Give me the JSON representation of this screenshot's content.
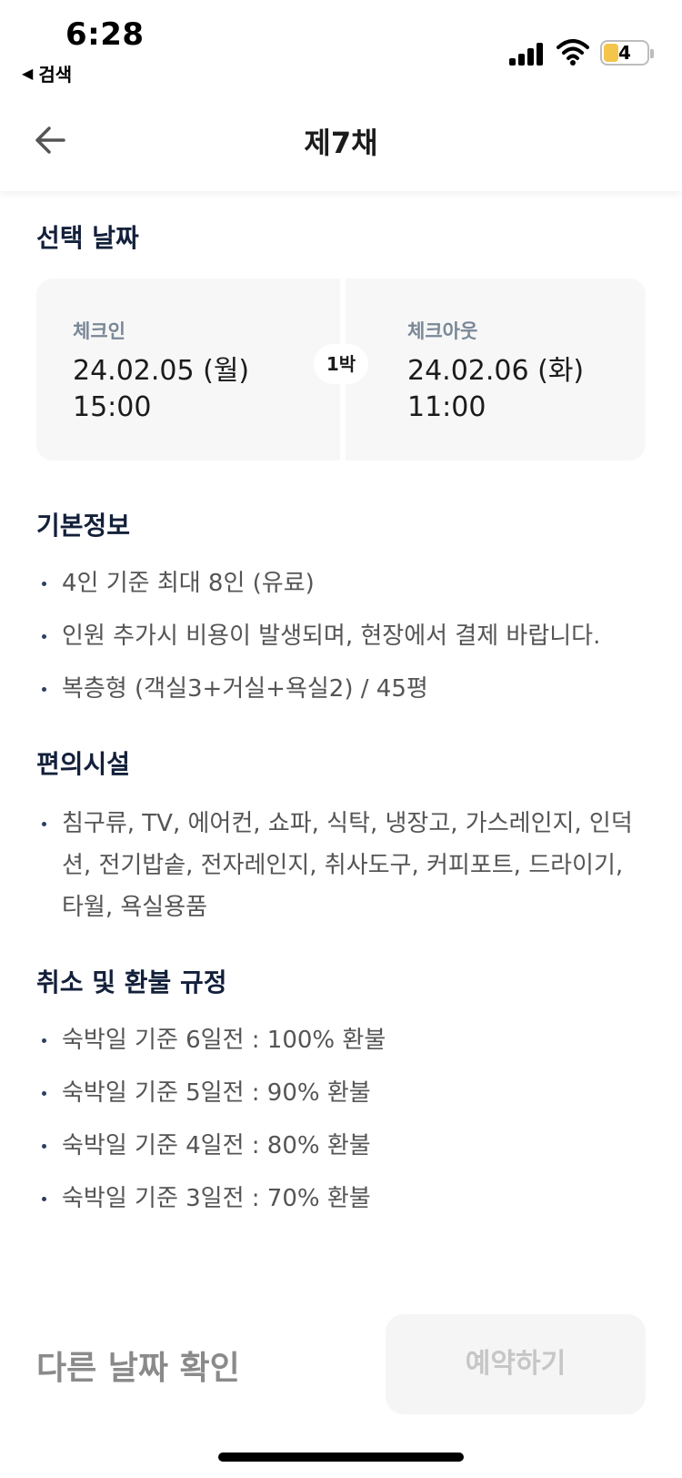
{
  "status_bar": {
    "time": "6:28",
    "back_app": "검색",
    "battery": "4"
  },
  "header": {
    "title": "제7채"
  },
  "selected_dates": {
    "section_title": "선택 날짜",
    "checkin_label": "체크인",
    "checkin_date": "24.02.05 (월)",
    "checkin_time": "15:00",
    "nights": "1박",
    "checkout_label": "체크아웃",
    "checkout_date": "24.02.06 (화)",
    "checkout_time": "11:00"
  },
  "basic_info": {
    "section_title": "기본정보",
    "items": [
      "4인 기준 최대 8인 (유료)",
      "인원 추가시 비용이 발생되며, 현장에서 결제 바랍니다.",
      "복층형 (객실3+거실+욕실2) / 45평"
    ]
  },
  "amenities": {
    "section_title": "편의시설",
    "items": [
      "침구류, TV, 에어컨, 쇼파, 식탁, 냉장고, 가스레인지, 인덕션, 전기밥솥, 전자레인지, 취사도구, 커피포트, 드라이기, 타월, 욕실용품"
    ]
  },
  "refund": {
    "section_title": "취소 및 환불 규정",
    "items": [
      "숙박일 기준 6일전 : 100% 환불",
      "숙박일 기준 5일전 : 90% 환불",
      "숙박일 기준 4일전 : 80% 환불",
      "숙박일 기준 3일전 : 70% 환불"
    ]
  },
  "bottom_bar": {
    "other_date_label": "다른 날짜 확인",
    "reserve_label": "예약하기"
  }
}
